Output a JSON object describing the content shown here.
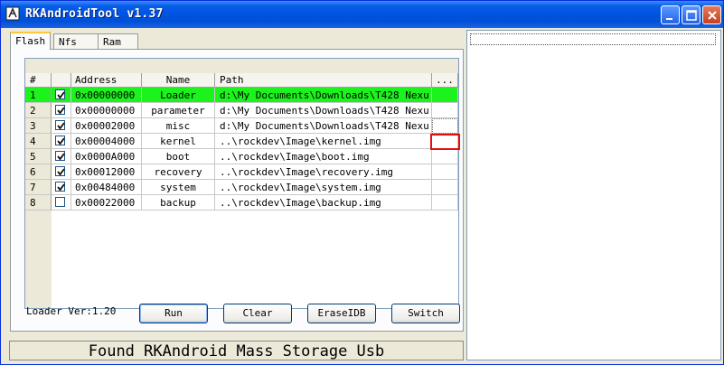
{
  "window": {
    "title": "RKAndroidTool v1.37"
  },
  "tabs": [
    {
      "label": "Flash"
    },
    {
      "label": "Nfs"
    },
    {
      "label": "Ram"
    }
  ],
  "table": {
    "columns": [
      "#",
      "",
      "Address",
      "Name",
      "Path",
      "..."
    ],
    "rows": [
      {
        "num": "1",
        "checked": true,
        "address": "0x00000000",
        "name": "Loader",
        "path": "d:\\My Documents\\Downloads\\T428 Nexu...",
        "selected": true
      },
      {
        "num": "2",
        "checked": true,
        "address": "0x00000000",
        "name": "parameter",
        "path": "d:\\My Documents\\Downloads\\T428 Nexu..."
      },
      {
        "num": "3",
        "checked": true,
        "address": "0x00002000",
        "name": "misc",
        "path": "d:\\My Documents\\Downloads\\T428 Nexu..."
      },
      {
        "num": "4",
        "checked": true,
        "address": "0x00004000",
        "name": "kernel",
        "path": "..\\rockdev\\Image\\kernel.img"
      },
      {
        "num": "5",
        "checked": true,
        "address": "0x0000A000",
        "name": "boot",
        "path": "..\\rockdev\\Image\\boot.img"
      },
      {
        "num": "6",
        "checked": true,
        "address": "0x00012000",
        "name": "recovery",
        "path": "..\\rockdev\\Image\\recovery.img"
      },
      {
        "num": "7",
        "checked": true,
        "address": "0x00484000",
        "name": "system",
        "path": "..\\rockdev\\Image\\system.img"
      },
      {
        "num": "8",
        "checked": false,
        "address": "0x00022000",
        "name": "backup",
        "path": "..\\rockdev\\Image\\backup.img"
      }
    ]
  },
  "loader_ver": "Loader Ver:1.20",
  "buttons": {
    "run": "Run",
    "clear": "Clear",
    "eraseidb": "EraseIDB",
    "switch": "Switch"
  },
  "status": "Found RKAndroid Mass Storage Usb",
  "colors": {
    "selected_row": "#1CF21C",
    "titlebar": "#0054E3",
    "highlight": "#E01010"
  }
}
